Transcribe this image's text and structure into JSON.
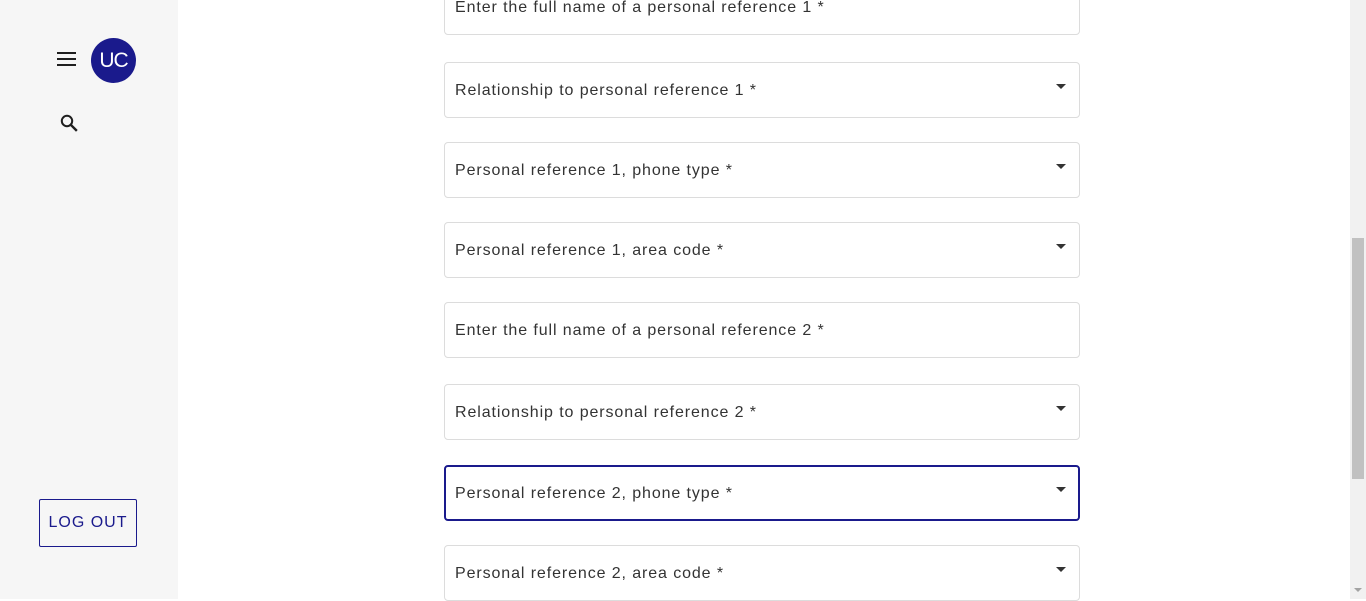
{
  "sidebar": {
    "menu_icon": "menu-icon",
    "avatar_initials": "UC",
    "search_icon": "search-icon",
    "logout_label": "LOG OUT"
  },
  "form": {
    "fields": [
      {
        "label": "Enter the full name of a personal reference 1 *",
        "type": "text"
      },
      {
        "label": "Relationship to personal reference 1 *",
        "type": "select"
      },
      {
        "label": "Personal reference 1, phone type *",
        "type": "select"
      },
      {
        "label": "Personal reference 1, area code *",
        "type": "select"
      },
      {
        "label": "Enter the full name of a personal reference 2 *",
        "type": "text"
      },
      {
        "label": "Relationship to personal reference 2 *",
        "type": "select"
      },
      {
        "label": "Personal reference 2, phone type *",
        "type": "select",
        "focused": true
      },
      {
        "label": "Personal reference 2, area code *",
        "type": "select"
      }
    ]
  },
  "colors": {
    "accent": "#1a1a8c",
    "sidebar_bg": "#f6f6f6",
    "field_border": "#dcdcdc"
  }
}
